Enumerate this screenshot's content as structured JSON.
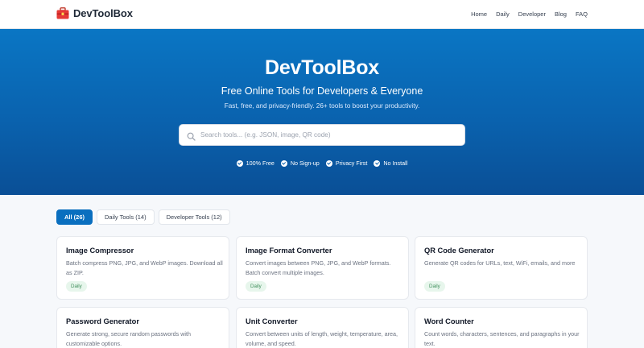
{
  "nav": {
    "brand": "DevToolBox",
    "links": [
      "Home",
      "Daily",
      "Developer",
      "Blog",
      "FAQ"
    ]
  },
  "hero": {
    "title": "DevToolBox",
    "subtitle": "Free Online Tools for Developers & Everyone",
    "tagline": "Fast, free, and privacy-friendly. 26+ tools to boost your productivity.",
    "search_placeholder": "Search tools... (e.g. JSON, image, QR code)",
    "badges": [
      "100% Free",
      "No Sign-up",
      "Privacy First",
      "No Install"
    ]
  },
  "filters": [
    {
      "label": "All (26)",
      "active": true
    },
    {
      "label": "Daily Tools (14)",
      "active": false
    },
    {
      "label": "Developer Tools (12)",
      "active": false
    }
  ],
  "cards": [
    {
      "title": "Image Compressor",
      "desc": "Batch compress PNG, JPG, and WebP images. Download all as ZIP.",
      "tag": "Daily"
    },
    {
      "title": "Image Format Converter",
      "desc": "Convert images between PNG, JPG, and WebP formats. Batch convert multiple images.",
      "tag": "Daily"
    },
    {
      "title": "QR Code Generator",
      "desc": "Generate QR codes for URLs, text, WiFi, emails, and more",
      "tag": "Daily"
    },
    {
      "title": "Password Generator",
      "desc": "Generate strong, secure random passwords with customizable options.",
      "tag": ""
    },
    {
      "title": "Unit Converter",
      "desc": "Convert between units of length, weight, temperature, area, volume, and speed.",
      "tag": ""
    },
    {
      "title": "Word Counter",
      "desc": "Count words, characters, sentences, and paragraphs in your text.",
      "tag": ""
    }
  ],
  "colors": {
    "primary": "#0a6fbf",
    "hero_top": "#0a76c4",
    "hero_bottom": "#0a4f96",
    "tag_bg": "#e7f6ec",
    "tag_text": "#3f8f5c"
  }
}
